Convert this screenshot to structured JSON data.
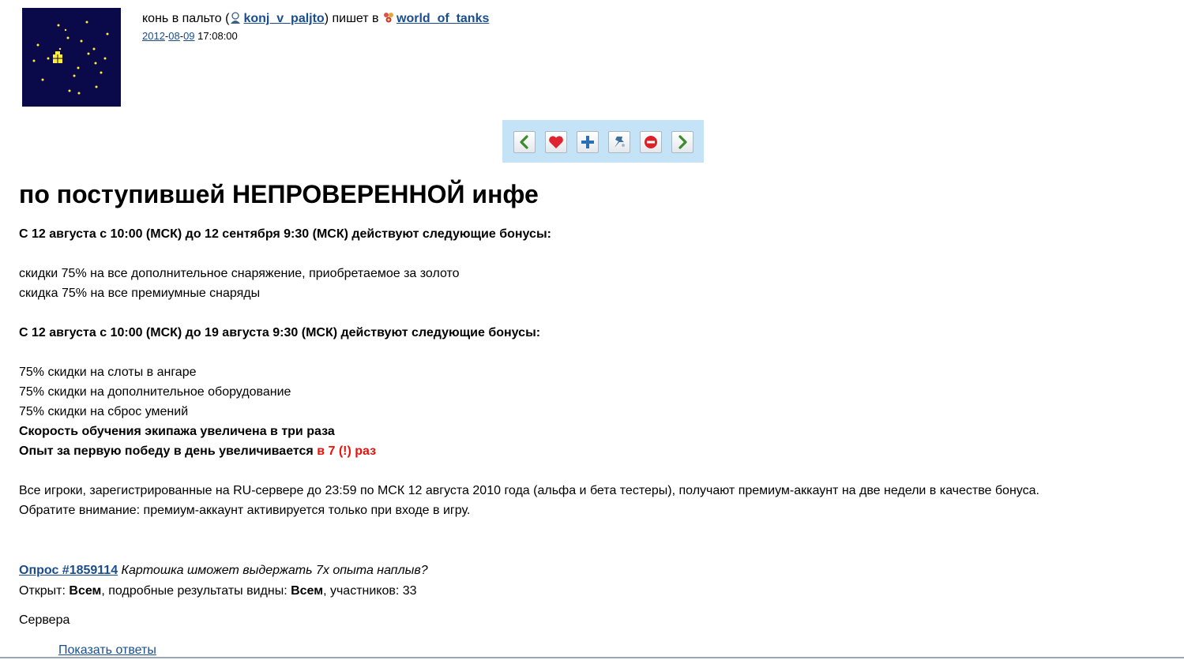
{
  "header": {
    "author_prefix": "конь в пальто (",
    "username": "konj_v_paljto",
    "writes_in": ") пишет в ",
    "community": "world_of_tanks",
    "date_year": "2012",
    "date_sep1": "-",
    "date_month": "08",
    "date_sep2": "-",
    "date_day": "09",
    "time": " 17:08:00"
  },
  "toolbar": {
    "buttons": [
      "prev-arrow-icon",
      "heart-icon",
      "plus-icon",
      "pin-icon",
      "minus-circle-icon",
      "next-arrow-icon"
    ]
  },
  "post": {
    "title": "по поступившей НЕПРОВЕРЕННОЙ инфе",
    "section1_heading": "С 12 августа с 10:00 (МСК) до 12 сентября 9:30 (МСК) действуют следующие бонусы:",
    "section1_items": [
      "скидки 75% на все дополнительное снаряжение, приобретаемое за золото",
      "скидка 75% на все премиумные снаряды"
    ],
    "section2_heading": "С 12 августа с 10:00 (МСК) до 19 августа 9:30 (МСК) действуют следующие бонусы:",
    "section2_items": [
      "75% скидки на слоты в ангаре",
      "75% скидки на дополнительное оборудование",
      "75% скидки на сброс умений"
    ],
    "crew_line": "Скорость обучения экипажа увеличена в три раза",
    "exp_line_prefix": "Опыт за первую победу в день увеличивается ",
    "exp_line_highlight": "в 7 (!) раз",
    "notice_line1": "Все игроки, зарегистрированные на RU-сервере до 23:59 по МСК 12 августа 2010 года (альфа и бета тестеры), получают премиум-аккаунт на две недели в качестве бонуса.",
    "notice_line2": "Обратите внимание: премиум-аккаунт активируется только при входе в игру."
  },
  "poll": {
    "link_label": "Опрос #1859114",
    "question": " Картошка шможет выдержать 7х опыта наплыв?",
    "open_label": "Открыт: ",
    "open_value": "Всем",
    "results_label": ", подробные результаты видны: ",
    "results_value": "Всем",
    "participants": ", участников: 33",
    "question_title": "Сервера",
    "show_answers": "Показать ответы"
  },
  "colors": {
    "link": "#1a4d8f",
    "highlight_red": "#e8120c",
    "toolbar_bg": "#c5e3f7",
    "userpic_bg": "#0a0a4a",
    "star": "#ffee33"
  }
}
